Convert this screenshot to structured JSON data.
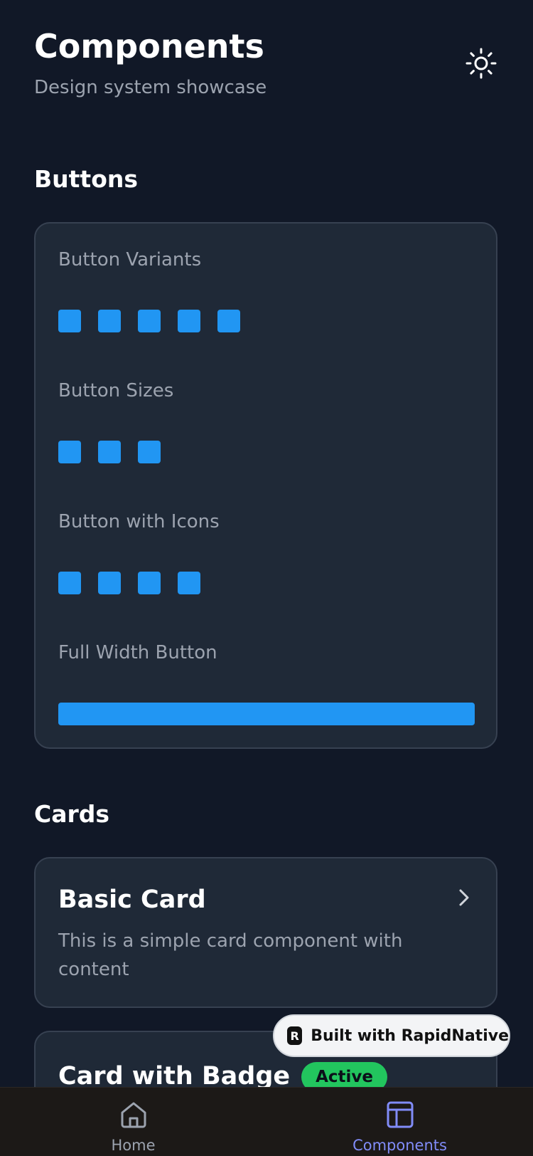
{
  "header": {
    "title": "Components",
    "subtitle": "Design system showcase",
    "theme_icon": "sun-icon"
  },
  "sections": {
    "buttons": {
      "title": "Buttons",
      "variants_label": "Button Variants",
      "sizes_label": "Button Sizes",
      "icons_label": "Button with Icons",
      "full_width_label": "Full Width Button"
    },
    "cards": {
      "title": "Cards",
      "basic_card": {
        "title": "Basic Card",
        "description": "This is a simple card component with content"
      },
      "badge_card": {
        "title": "Card with Badge",
        "badge": "Active"
      }
    }
  },
  "builtwith": {
    "logo": "R",
    "label": "Built with RapidNative"
  },
  "tabbar": {
    "home_label": "Home",
    "components_label": "Components",
    "active_tab": "Components"
  },
  "colors": {
    "background": "#111827",
    "card": "#1f2937",
    "card_border": "#374151",
    "button_blue": "#2196f3",
    "badge_green": "#22c55e",
    "tab_active": "#818cf8",
    "tab_inactive": "#9ca3af"
  }
}
